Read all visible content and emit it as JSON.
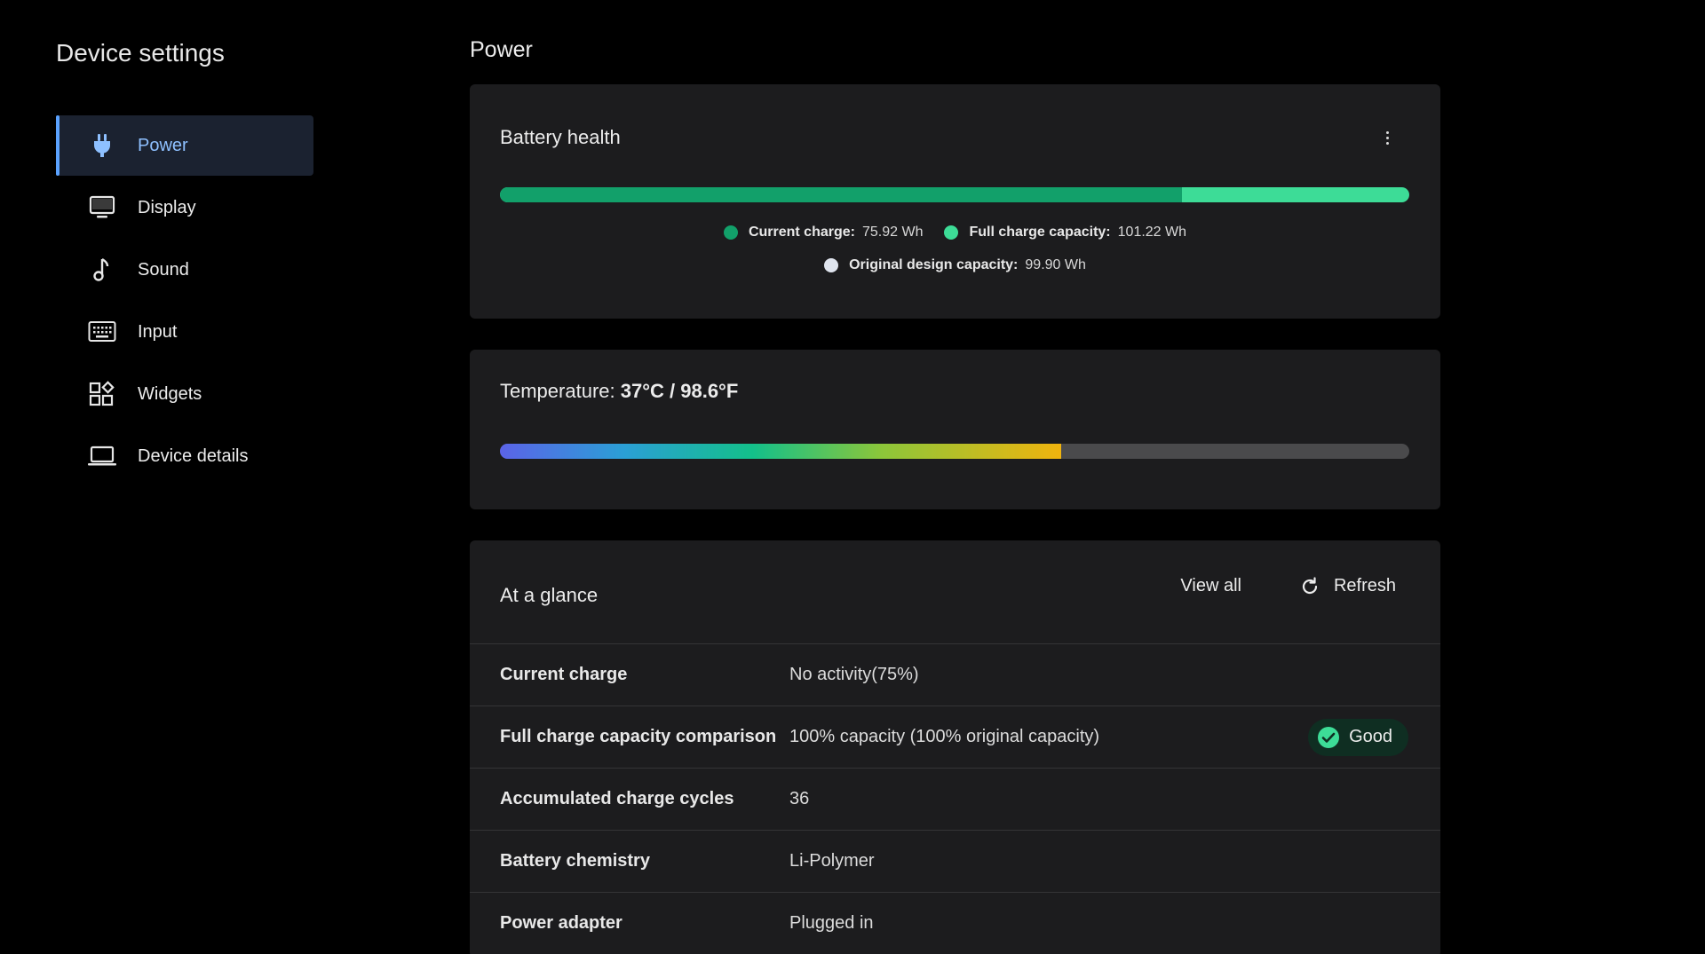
{
  "sidebar": {
    "title": "Device settings",
    "items": [
      {
        "label": "Power",
        "icon": "plug-icon"
      },
      {
        "label": "Display",
        "icon": "monitor-icon"
      },
      {
        "label": "Sound",
        "icon": "music-note-icon"
      },
      {
        "label": "Input",
        "icon": "keyboard-icon"
      },
      {
        "label": "Widgets",
        "icon": "widgets-icon"
      },
      {
        "label": "Device details",
        "icon": "laptop-icon"
      }
    ],
    "active_index": 0
  },
  "main": {
    "title": "Power",
    "battery_health": {
      "title": "Battery health",
      "current_charge_fraction": 0.75,
      "legend": [
        {
          "label": "Current charge:",
          "value": "75.92 Wh",
          "color": "#12a06a"
        },
        {
          "label": "Full charge capacity:",
          "value": "101.22 Wh",
          "color": "#3ddc97"
        },
        {
          "label": "Original design capacity:",
          "value": "99.90 Wh",
          "color": "#dfe4ee"
        }
      ]
    },
    "temperature": {
      "label": "Temperature:",
      "value": "37°C / 98.6°F",
      "level_fraction": 0.617
    },
    "at_a_glance": {
      "title": "At a glance",
      "view_all_label": "View all",
      "refresh_label": "Refresh",
      "rows": [
        {
          "label": "Current charge",
          "value": "No activity(75%)"
        },
        {
          "label": "Full charge capacity comparison",
          "value": "100% capacity (100% original capacity)",
          "badge": "Good"
        },
        {
          "label": "Accumulated charge cycles",
          "value": "36"
        },
        {
          "label": "Battery chemistry",
          "value": "Li-Polymer"
        },
        {
          "label": "Power adapter",
          "value": "Plugged in"
        }
      ]
    }
  },
  "colors": {
    "accent": "#8ec0ff",
    "active_bg": "#1b2230",
    "card_bg": "#1c1c1e",
    "good": "#3ddc97"
  }
}
